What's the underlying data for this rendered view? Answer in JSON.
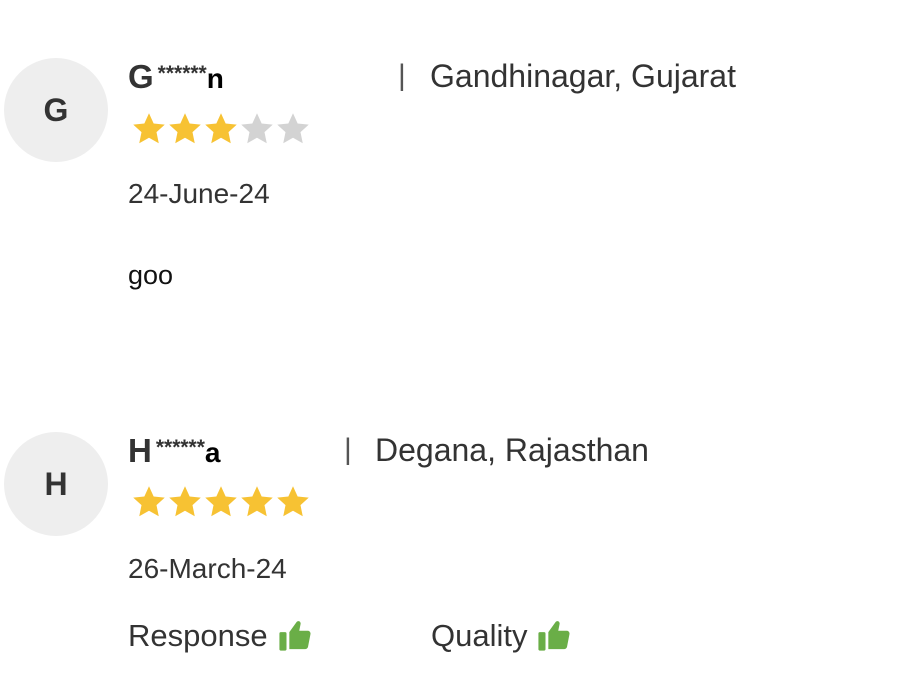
{
  "reviews": [
    {
      "avatar_initial": "G",
      "name_initial": "G",
      "name_mask": "******",
      "name_last": "n",
      "separator": "|",
      "location": "Gandhinagar, Gujarat",
      "rating": 3,
      "max_rating": 5,
      "date": "24-June-24",
      "comment": "goo"
    },
    {
      "avatar_initial": "H",
      "name_initial": "H",
      "name_mask": "******",
      "name_last": "a",
      "separator": "|",
      "location": "Degana, Rajasthan",
      "rating": 5,
      "max_rating": 5,
      "date": "26-March-24",
      "feedback": [
        {
          "label": "Response",
          "icon": "thumbs-up-icon"
        },
        {
          "label": "Quality",
          "icon": "thumbs-up-icon"
        }
      ]
    }
  ],
  "colors": {
    "star_filled": "#F7C233",
    "star_empty": "#D3D3D3",
    "thumb": "#6AAE47",
    "avatar_bg": "#EEEEEE"
  }
}
